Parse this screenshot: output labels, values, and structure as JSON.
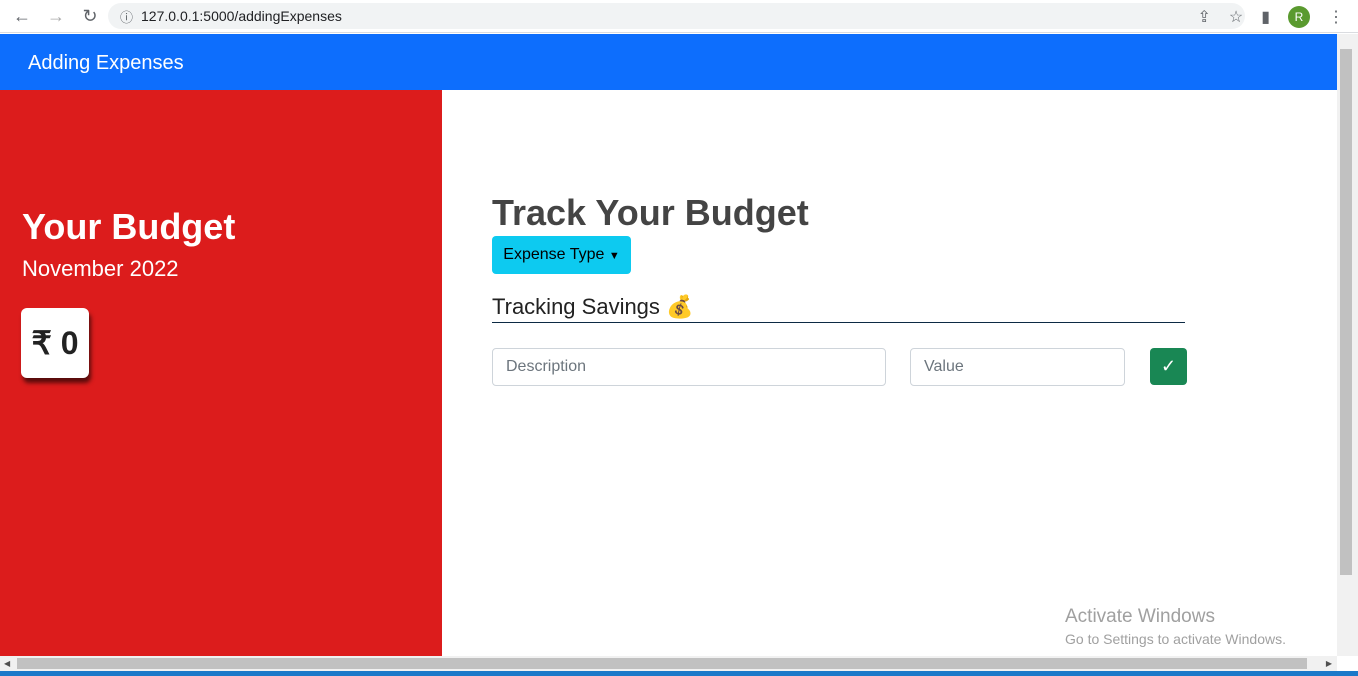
{
  "browser": {
    "url": "127.0.0.1:5000/addingExpenses",
    "profile_initial": "R"
  },
  "navbar": {
    "title": "Adding Expenses"
  },
  "budget": {
    "title": "Your Budget",
    "month": "November 2022",
    "amount": "₹ 0"
  },
  "main": {
    "title": "Track Your Budget",
    "dropdown_label": "Expense Type",
    "section_title": "Tracking Savings 💰",
    "description_placeholder": "Description",
    "value_placeholder": "Value",
    "submit_label": "✓"
  },
  "watermark": {
    "title": "Activate Windows",
    "subtitle": "Go to Settings to activate Windows."
  }
}
